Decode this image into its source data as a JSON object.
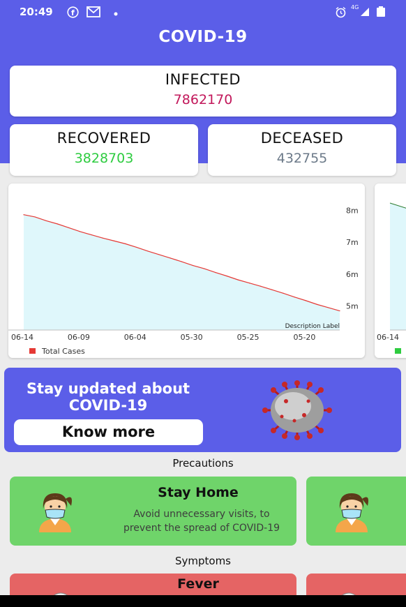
{
  "status": {
    "time": "20:49",
    "network": "4G"
  },
  "app": {
    "title": "COVID-19"
  },
  "stats": {
    "infected": {
      "label": "INFECTED",
      "value": "7862170",
      "color": "#c2185b"
    },
    "recovered": {
      "label": "RECOVERED",
      "value": "3828703",
      "color": "#2ecc40"
    },
    "deceased": {
      "label": "DECEASED",
      "value": "432755",
      "color": "#6c7a89"
    }
  },
  "chart_data": {
    "type": "area",
    "x": [
      "06-14",
      "06-13",
      "06-12",
      "06-11",
      "06-10",
      "06-09",
      "06-08",
      "06-07",
      "06-06",
      "06-05",
      "06-04",
      "06-03",
      "06-02",
      "06-01",
      "05-31",
      "05-30",
      "05-29",
      "05-28",
      "05-27",
      "05-26",
      "05-25",
      "05-24",
      "05-23",
      "05-22",
      "05-21",
      "05-20",
      "05-19",
      "05-18",
      "05-17"
    ],
    "x_ticks": [
      "06-14",
      "06-09",
      "06-04",
      "05-30",
      "05-25",
      "05-20"
    ],
    "series": [
      {
        "name": "Total Cases",
        "color": "#e53935",
        "fill": "#dff7fb",
        "values": [
          7.86,
          7.79,
          7.67,
          7.57,
          7.45,
          7.33,
          7.23,
          7.13,
          7.04,
          6.95,
          6.84,
          6.72,
          6.61,
          6.5,
          6.39,
          6.27,
          6.17,
          6.05,
          5.94,
          5.82,
          5.72,
          5.62,
          5.51,
          5.4,
          5.28,
          5.17,
          5.05,
          4.95,
          4.85
        ]
      }
    ],
    "y_ticks": [
      "5m",
      "6m",
      "7m",
      "8m"
    ],
    "ylim": [
      4.25,
      8.4
    ],
    "description": "Description Label",
    "legend": "bottom-left"
  },
  "chart2": {
    "x_tick": "06-14"
  },
  "banner": {
    "line1": "Stay updated about",
    "line2": "COVID-19",
    "button": "Know more"
  },
  "precautions": {
    "title": "Precautions",
    "items": [
      {
        "title": "Stay Home",
        "desc_line1": "Avoid unnecessary visits, to",
        "desc_line2": "prevent the spread of COVID-19"
      }
    ]
  },
  "symptoms": {
    "title": "Symptoms",
    "items": [
      {
        "title": "Fever"
      }
    ]
  },
  "colors": {
    "primary": "#5b5ee8",
    "precaution": "#6fd46a",
    "symptom": "#e56464"
  }
}
